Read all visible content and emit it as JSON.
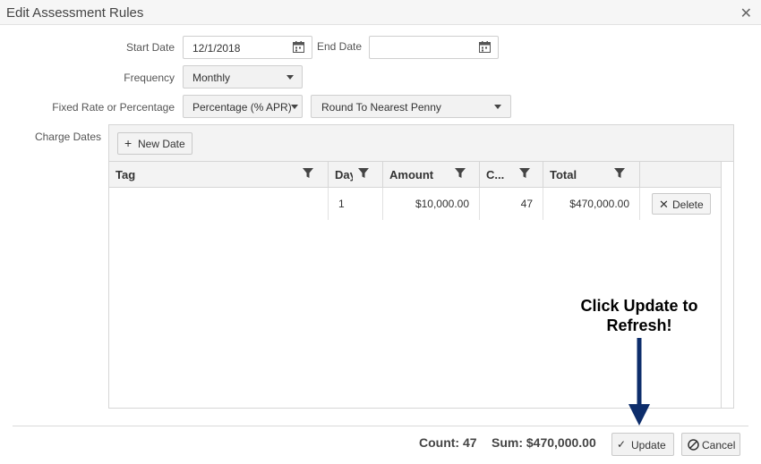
{
  "dialog": {
    "title": "Edit Assessment Rules",
    "close_icon": "close-icon"
  },
  "form": {
    "start_date_label": "Start Date",
    "start_date_value": "12/1/2018",
    "end_date_label": "End Date",
    "end_date_value": "",
    "frequency_label": "Frequency",
    "frequency_value": "Monthly",
    "rate_label": "Fixed Rate or Percentage",
    "rate_value": "Percentage (% APR)",
    "rounding_value": "Round To Nearest Penny",
    "charge_dates_label": "Charge Dates"
  },
  "grid": {
    "new_date_label": "New Date",
    "columns": [
      "Tag",
      "Day",
      "Amount",
      "C...",
      "Total"
    ],
    "rows": [
      {
        "tag": "",
        "day": "1",
        "amount": "$10,000.00",
        "count": "47",
        "total": "$470,000.00",
        "delete_label": "Delete"
      }
    ]
  },
  "footer": {
    "count_text": "Count: 47",
    "sum_text": "Sum: $470,000.00",
    "update_label": "Update",
    "cancel_label": "Cancel"
  },
  "annotation": {
    "line1": "Click Update to",
    "line2": "Refresh!",
    "arrow_color": "#0d2d6b"
  }
}
